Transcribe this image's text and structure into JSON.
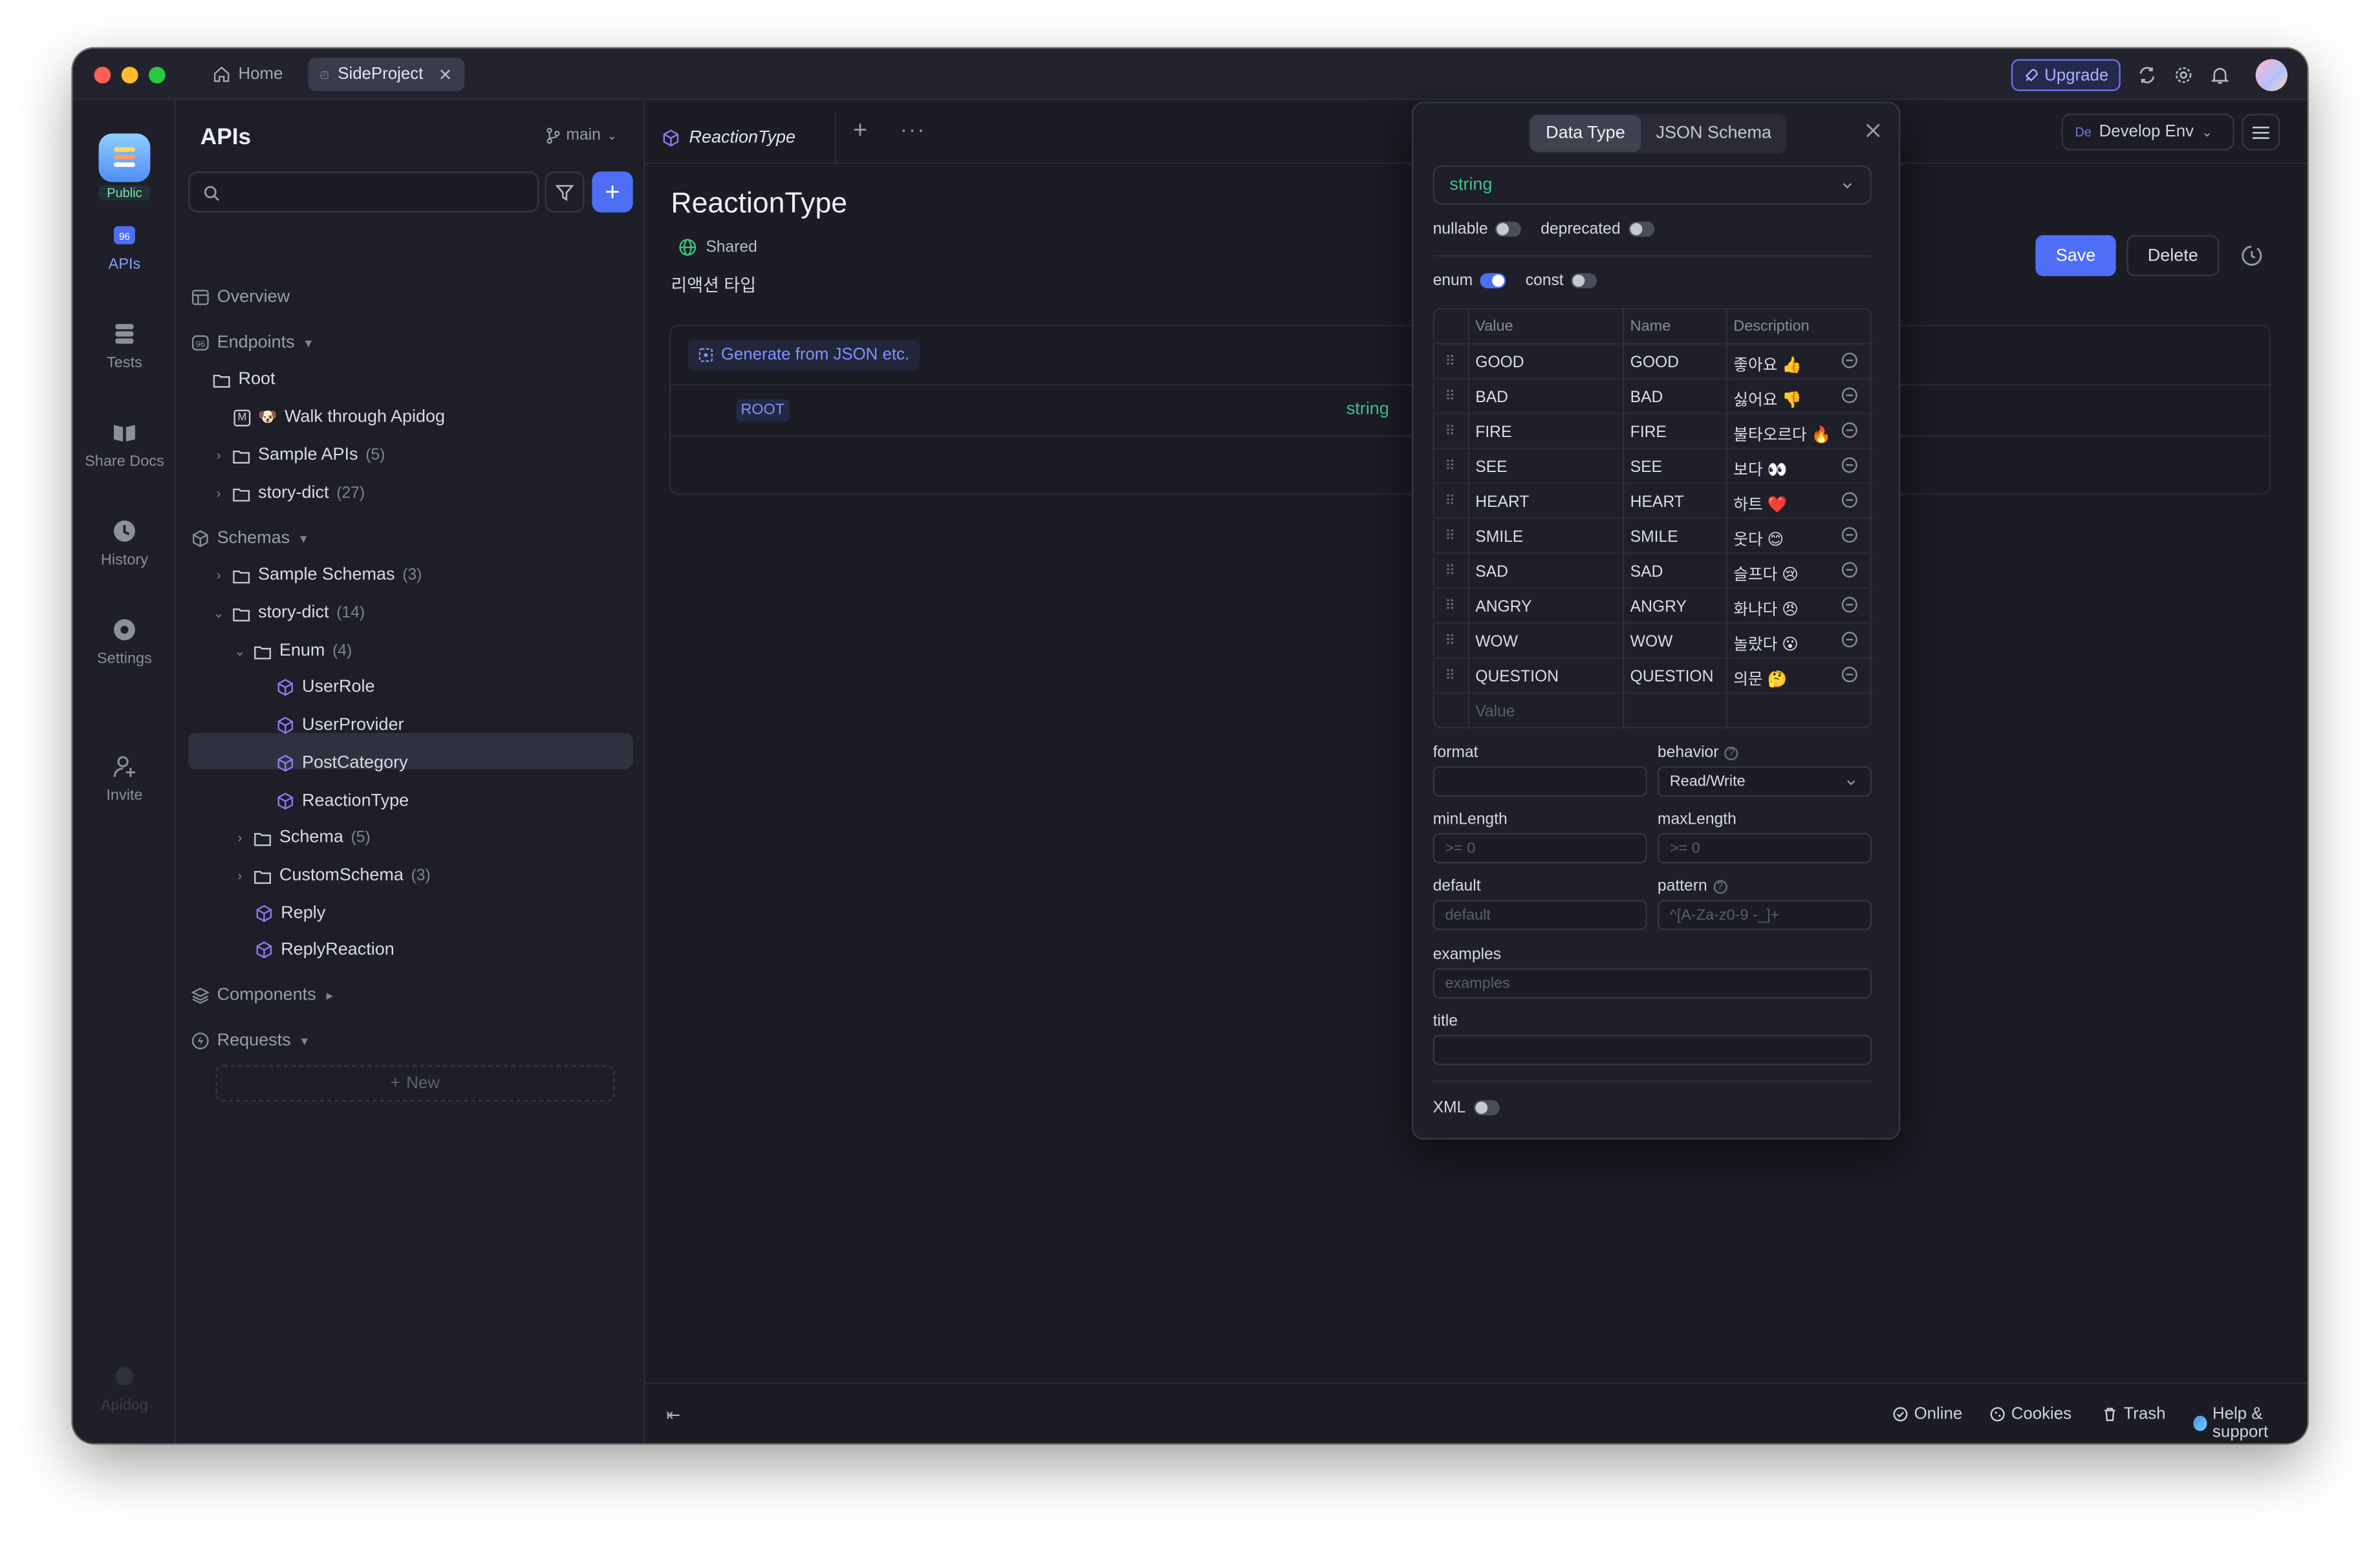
{
  "titlebar": {
    "home_tab": "Home",
    "project_tab": "SideProject",
    "upgrade_label": "Upgrade"
  },
  "rail": {
    "public_badge": "Public",
    "items": [
      {
        "label": "APIs",
        "icon": "apis-icon"
      },
      {
        "label": "Tests",
        "icon": "tests-icon"
      },
      {
        "label": "Share Docs",
        "icon": "share-docs-icon"
      },
      {
        "label": "History",
        "icon": "history-icon"
      },
      {
        "label": "Settings",
        "icon": "settings-icon"
      },
      {
        "label": "Invite",
        "icon": "invite-icon"
      }
    ],
    "footer_logo": "Apidog"
  },
  "sidebar": {
    "title": "APIs",
    "branch": "main",
    "new_label": "New",
    "tree": [
      {
        "label": "Overview",
        "count": ""
      },
      {
        "label": "Endpoints",
        "count": ""
      },
      {
        "label": "Root",
        "count": ""
      },
      {
        "label": "Walk through Apidog",
        "count": "",
        "method": "M"
      },
      {
        "label": "Sample APIs",
        "count": "(5)"
      },
      {
        "label": "story-dict",
        "count": "(27)"
      },
      {
        "label": "Schemas",
        "count": ""
      },
      {
        "label": "Sample Schemas",
        "count": "(3)"
      },
      {
        "label": "story-dict",
        "count": "(14)"
      },
      {
        "label": "Enum",
        "count": "(4)"
      },
      {
        "label": "UserRole",
        "count": ""
      },
      {
        "label": "UserProvider",
        "count": ""
      },
      {
        "label": "PostCategory",
        "count": ""
      },
      {
        "label": "ReactionType",
        "count": ""
      },
      {
        "label": "Schema",
        "count": "(5)"
      },
      {
        "label": "CustomSchema",
        "count": "(3)"
      },
      {
        "label": "Reply",
        "count": ""
      },
      {
        "label": "ReplyReaction",
        "count": ""
      },
      {
        "label": "Components",
        "count": ""
      },
      {
        "label": "Requests",
        "count": ""
      }
    ]
  },
  "main": {
    "tab_label": "ReactionType",
    "env_label": "Develop Env",
    "env_badge": "De",
    "title": "ReactionType",
    "shared_label": "Shared",
    "description": "리액션 타입",
    "save_label": "Save",
    "delete_label": "Delete",
    "generate_label": "Generate from JSON etc.",
    "root_label": "ROOT",
    "root_type": "string"
  },
  "panel": {
    "tab_data_type": "Data Type",
    "tab_json_schema": "JSON Schema",
    "type_value": "string",
    "toggles": {
      "nullable": "nullable",
      "deprecated": "deprecated",
      "enum": "enum",
      "const": "const",
      "xml": "XML"
    },
    "enum_table": {
      "headers": [
        "Value",
        "Name",
        "Description"
      ],
      "rows": [
        {
          "value": "GOOD",
          "name": "GOOD",
          "desc": "좋아요 👍"
        },
        {
          "value": "BAD",
          "name": "BAD",
          "desc": "싫어요 👎"
        },
        {
          "value": "FIRE",
          "name": "FIRE",
          "desc": "불타오르다 🔥"
        },
        {
          "value": "SEE",
          "name": "SEE",
          "desc": "보다 👀"
        },
        {
          "value": "HEART",
          "name": "HEART",
          "desc": "하트 ❤️"
        },
        {
          "value": "SMILE",
          "name": "SMILE",
          "desc": "웃다 😊"
        },
        {
          "value": "SAD",
          "name": "SAD",
          "desc": "슬프다 😢"
        },
        {
          "value": "ANGRY",
          "name": "ANGRY",
          "desc": "화나다 😠"
        },
        {
          "value": "WOW",
          "name": "WOW",
          "desc": "놀랐다 😮"
        },
        {
          "value": "QUESTION",
          "name": "QUESTION",
          "desc": "의문 🤔"
        }
      ],
      "new_value_placeholder": "Value"
    },
    "fields": {
      "format_label": "format",
      "behavior_label": "behavior",
      "behavior_value": "Read/Write",
      "minlength_label": "minLength",
      "minlength_placeholder": ">= 0",
      "maxlength_label": "maxLength",
      "maxlength_placeholder": ">= 0",
      "default_label": "default",
      "default_placeholder": "default",
      "pattern_label": "pattern",
      "pattern_placeholder": "^[A-Za-z0-9 -_]+",
      "examples_label": "examples",
      "examples_placeholder": "examples",
      "title_label": "title"
    }
  },
  "bottombar": {
    "online": "Online",
    "cookies": "Cookies",
    "trash": "Trash",
    "help": "Help & support"
  },
  "colors": {
    "accent": "#4d6ef5",
    "type_green": "#3fc386",
    "schema_purple": "#8f7cf5"
  }
}
